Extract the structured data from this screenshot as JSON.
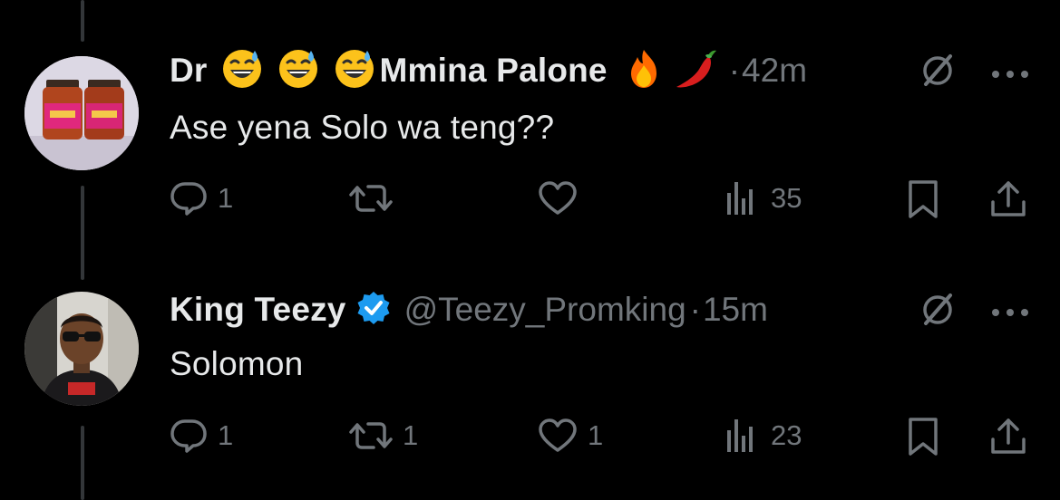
{
  "tweets": [
    {
      "name_prefix": "Dr",
      "name_main": "Mmina Palone",
      "emojis_before": [
        "sweat-smile",
        "sweat-smile",
        "sweat-smile"
      ],
      "emojis_after": [
        "fire",
        "hot-pepper"
      ],
      "handle": "",
      "separator": "·",
      "time": "42m",
      "text": "Ase yena Solo wa teng??",
      "replies": "1",
      "retweets": "",
      "likes": "",
      "views": "35",
      "avatar": "product-jars"
    },
    {
      "name_main": "King Teezy",
      "verified": true,
      "handle": "@Teezy_Promking",
      "separator": "·",
      "time": "15m",
      "text": "Solomon",
      "replies": "1",
      "retweets": "1",
      "likes": "1",
      "views": "23",
      "avatar": "man-sunglasses"
    }
  ],
  "colors": {
    "background": "#000000",
    "text": "#e7e9ea",
    "muted": "#71767b",
    "thread_line": "#333639",
    "verified": "#1d9bf0"
  }
}
